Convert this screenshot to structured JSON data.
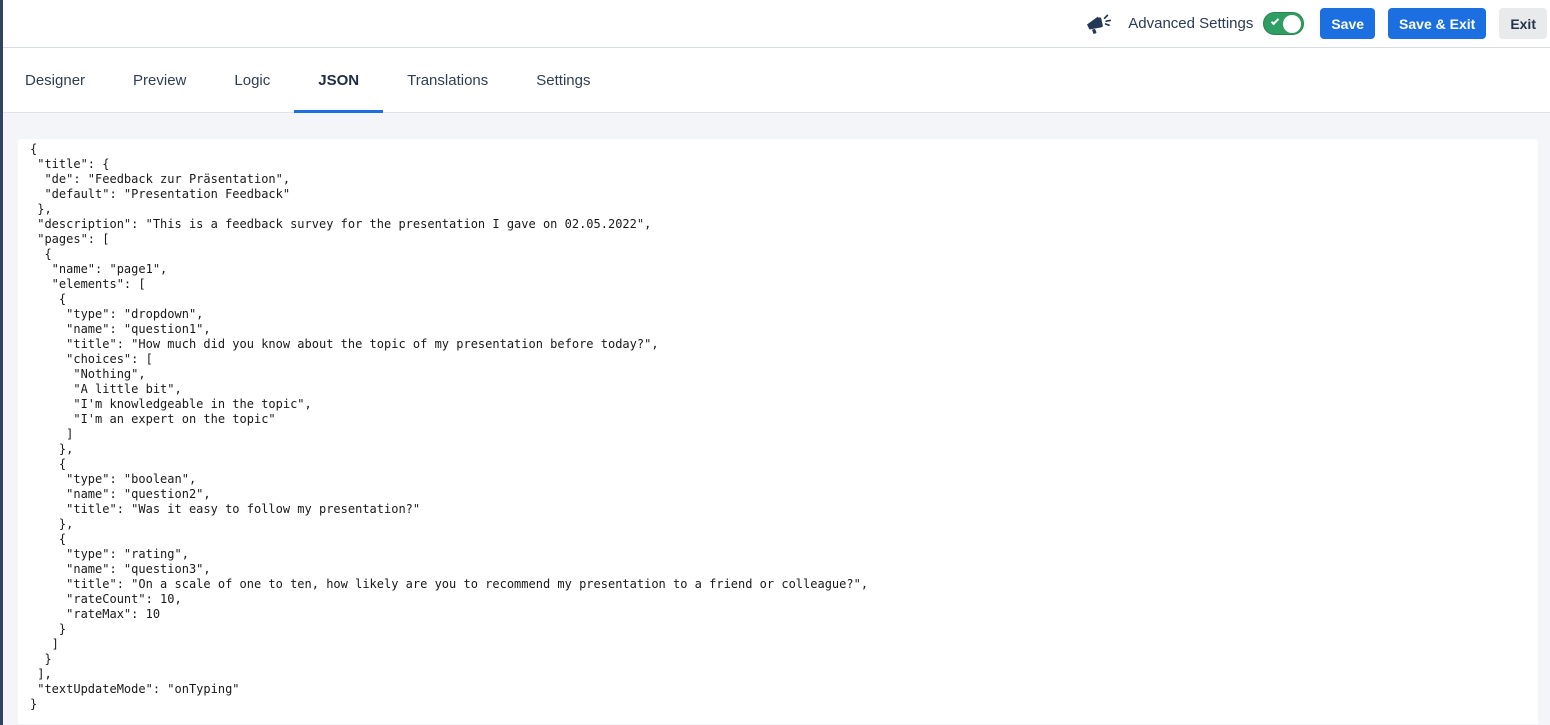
{
  "header": {
    "announcement_icon": "megaphone",
    "advanced_settings_label": "Advanced Settings",
    "advanced_settings_toggle": "on",
    "save_button": "Save",
    "save_exit_button": "Save & Exit",
    "exit_button": "Exit"
  },
  "colors": {
    "primary_blue": "#1c6fe0",
    "toggle_green": "#2f9e62",
    "navy_text": "#2b3a55",
    "page_background": "#f4f5f9",
    "editor_background": "#ffffff"
  },
  "tabs": [
    {
      "label": "Designer",
      "active": false
    },
    {
      "label": "Preview",
      "active": false
    },
    {
      "label": "Logic",
      "active": false
    },
    {
      "label": "JSON",
      "active": true
    },
    {
      "label": "Translations",
      "active": false
    },
    {
      "label": "Settings",
      "active": false
    }
  ],
  "editor": {
    "json_text": "{\n \"title\": {\n  \"de\": \"Feedback zur Präsentation\",\n  \"default\": \"Presentation Feedback\"\n },\n \"description\": \"This is a feedback survey for the presentation I gave on 02.05.2022\",\n \"pages\": [\n  {\n   \"name\": \"page1\",\n   \"elements\": [\n    {\n     \"type\": \"dropdown\",\n     \"name\": \"question1\",\n     \"title\": \"How much did you know about the topic of my presentation before today?\",\n     \"choices\": [\n      \"Nothing\",\n      \"A little bit\",\n      \"I'm knowledgeable in the topic\",\n      \"I'm an expert on the topic\"\n     ]\n    },\n    {\n     \"type\": \"boolean\",\n     \"name\": \"question2\",\n     \"title\": \"Was it easy to follow my presentation?\"\n    },\n    {\n     \"type\": \"rating\",\n     \"name\": \"question3\",\n     \"title\": \"On a scale of one to ten, how likely are you to recommend my presentation to a friend or colleague?\",\n     \"rateCount\": 10,\n     \"rateMax\": 10\n    }\n   ]\n  }\n ],\n \"textUpdateMode\": \"onTyping\"\n}"
  }
}
